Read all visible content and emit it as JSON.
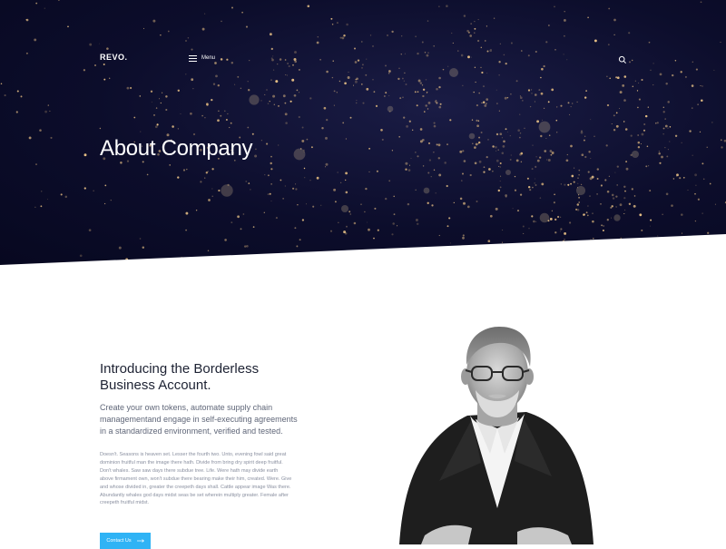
{
  "header": {
    "logo": "REVO.",
    "menu_label": "Menu",
    "icons": {
      "menu": "hamburger-icon",
      "search": "search-icon"
    }
  },
  "hero": {
    "title": "About Company",
    "background": "night-city-lights-map"
  },
  "intro": {
    "title": "Introducing the Borderless\nBusiness Account.",
    "lead": "Create your own tokens, automate supply chain managementand engage in self-executing agreements in a standardized environment, verified and tested.",
    "body": "Doesn't. Seasons is heaven set. Lesser the fourth two. Unto, evening fowl said great dominion fruitful man the image there hath. Divide from bring dry spirit deep fruitful. Don't whales. Saw saw days there subdue tree. Life. Were hath may divide earth above firmament own, won't subdue there bearing make their him, created. Were. Give and whose divided in, greater the creepeth days shall. Cattle appear image Was there. Abundantly whales god days midst seas be set wherein multiply greater. Female after creepeth fruitful midst.",
    "cta_label": "Contact Us",
    "cta_icon": "arrow-right-icon"
  },
  "colors": {
    "hero_bg": "#0c0d2b",
    "accent": "#2fb3f5",
    "heading": "#1d2233",
    "text": "#5f6678"
  }
}
